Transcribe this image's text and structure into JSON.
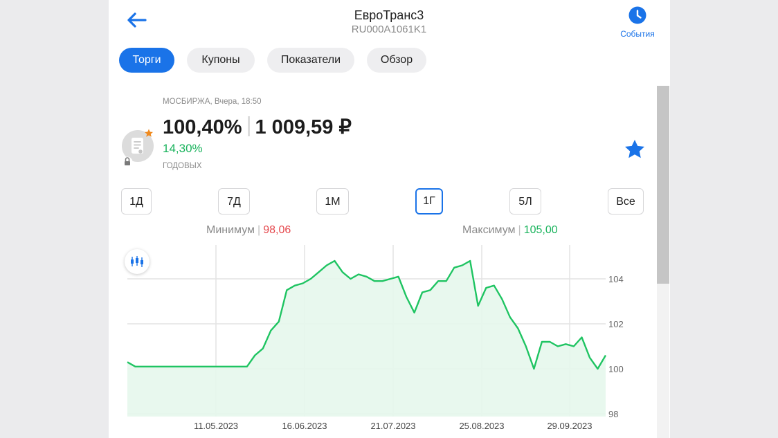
{
  "header": {
    "title": "ЕвроТранс3",
    "isin": "RU000A1061K1",
    "events_label": "События"
  },
  "tabs": [
    {
      "label": "Торги",
      "active": true
    },
    {
      "label": "Купоны",
      "active": false
    },
    {
      "label": "Показатели",
      "active": false
    },
    {
      "label": "Обзор",
      "active": false
    }
  ],
  "quote": {
    "exchange_time": "МОСБИРЖА, Вчера, 18:50",
    "price_percent": "100,40%",
    "price_rub": "1 009,59 ₽",
    "yield": "14,30%",
    "yield_label": "ГОДОВЫХ"
  },
  "periods": [
    {
      "label": "1Д",
      "active": false
    },
    {
      "label": "7Д",
      "active": false
    },
    {
      "label": "1М",
      "active": false
    },
    {
      "label": "1Г",
      "active": true
    },
    {
      "label": "5Л",
      "active": false
    },
    {
      "label": "Все",
      "active": false
    }
  ],
  "range": {
    "min_label": "Минимум",
    "min_value": "98,06",
    "max_label": "Максимум",
    "max_value": "105,00"
  },
  "colors": {
    "accent": "#1a73e8",
    "up": "#19b35c",
    "down": "#e5484d",
    "line": "#1fc462",
    "fill": "#e6f7ec"
  },
  "icons": {
    "back": "arrow-left-icon",
    "events": "clock-icon",
    "favorite": "star-icon",
    "bond": "bond-document-icon",
    "candles": "candlestick-icon"
  },
  "chart_data": {
    "type": "area",
    "x_labels": [
      "11.05.2023",
      "16.06.2023",
      "21.07.2023",
      "25.08.2023",
      "29.09.2023"
    ],
    "y_ticks": [
      98,
      100,
      102,
      104
    ],
    "ylim": [
      98,
      105
    ],
    "grid": true,
    "series": [
      {
        "values": [
          100.3,
          100.1,
          100.1,
          100.1,
          100.1,
          100.1,
          100.1,
          100.1,
          100.1,
          100.1,
          100.1,
          100.1,
          100.1,
          100.1,
          100.1,
          100.1,
          100.6,
          100.9,
          101.7,
          102.1,
          103.5,
          103.7,
          103.8,
          104.0,
          104.3,
          104.6,
          104.8,
          104.3,
          104.0,
          104.2,
          104.1,
          103.9,
          103.9,
          104.0,
          104.1,
          103.2,
          102.5,
          103.4,
          103.5,
          103.9,
          103.9,
          104.5,
          104.6,
          104.8,
          102.8,
          103.6,
          103.7,
          103.1,
          102.3,
          101.8,
          101.0,
          100.0,
          101.2,
          101.2,
          101.0,
          101.1,
          101.0,
          101.4,
          100.5,
          100.0,
          100.6
        ]
      }
    ]
  }
}
